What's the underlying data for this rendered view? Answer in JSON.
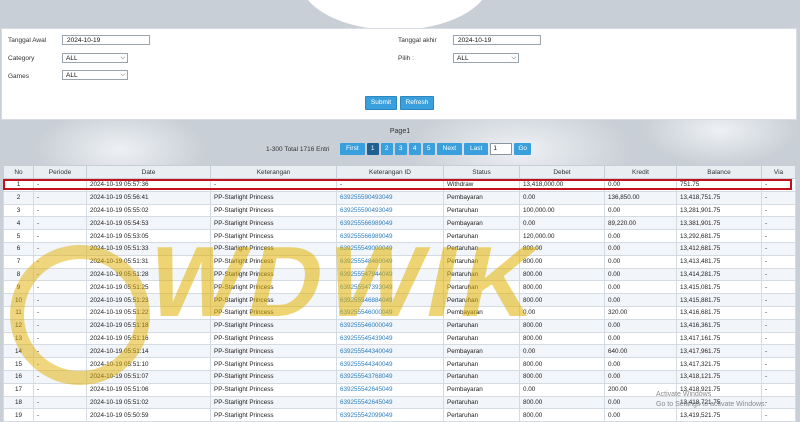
{
  "filters": {
    "tanggal_awal_label": "Tanggal Awal",
    "tanggal_awal_value": "2024-10-19",
    "tanggal_akhir_label": "Tanggal akhir",
    "tanggal_akhir_value": "2024-10-19",
    "category_label": "Category",
    "category_value": "ALL",
    "pilih_label": "Pilih :",
    "pilih_value": "ALL",
    "games_label": "Games",
    "games_value": "ALL",
    "submit_label": "Submit",
    "refresh_label": "Refresh"
  },
  "pagination": {
    "page_title": "Page1",
    "total_text": "1-300 Total 1716 Entri",
    "first": "First",
    "pages": [
      "1",
      "2",
      "3",
      "4",
      "5"
    ],
    "active_page": "1",
    "next": "Next",
    "last": "Last",
    "go_input": "1",
    "go": "Go"
  },
  "table": {
    "headers": [
      "No",
      "Periode",
      "Date",
      "Keterangan",
      "Keterangan ID",
      "Status",
      "Debet",
      "Kredit",
      "Balance",
      "Via"
    ],
    "rows": [
      [
        "1",
        "-",
        "2024-10-19 05:57:36",
        "-",
        "-",
        "Withdraw",
        "13,418,000.00",
        "0.00",
        "751.75",
        "-"
      ],
      [
        "2",
        "-",
        "2024-10-19 05:56:41",
        "PP-Starlight Princess",
        "639255590493049",
        "Pembayaran",
        "0.00",
        "136,850.00",
        "13,418,751.75",
        "-"
      ],
      [
        "3",
        "-",
        "2024-10-19 05:55:02",
        "PP-Starlight Princess",
        "639255590493049",
        "Pertaruhan",
        "100,000.00",
        "0.00",
        "13,281,901.75",
        "-"
      ],
      [
        "4",
        "-",
        "2024-10-19 05:54:53",
        "PP-Starlight Princess",
        "639255566989049",
        "Pembayaran",
        "0.00",
        "89,220.00",
        "13,381,901.75",
        "-"
      ],
      [
        "5",
        "-",
        "2024-10-19 05:53:05",
        "PP-Starlight Princess",
        "639255566989049",
        "Pertaruhan",
        "120,000.00",
        "0.00",
        "13,292,681.75",
        "-"
      ],
      [
        "6",
        "-",
        "2024-10-19 05:51:33",
        "PP-Starlight Princess",
        "639255549000049",
        "Pertaruhan",
        "800.00",
        "0.00",
        "13,412,681.75",
        "-"
      ],
      [
        "7",
        "-",
        "2024-10-19 05:51:31",
        "PP-Starlight Princess",
        "639255548460049",
        "Pertaruhan",
        "800.00",
        "0.00",
        "13,413,481.75",
        "-"
      ],
      [
        "8",
        "-",
        "2024-10-19 05:51:28",
        "PP-Starlight Princess",
        "639255547944049",
        "Pertaruhan",
        "800.00",
        "0.00",
        "13,414,281.75",
        "-"
      ],
      [
        "9",
        "-",
        "2024-10-19 05:51:25",
        "PP-Starlight Princess",
        "639255547393049",
        "Pertaruhan",
        "800.00",
        "0.00",
        "13,415,081.75",
        "-"
      ],
      [
        "10",
        "-",
        "2024-10-19 05:51:23",
        "PP-Starlight Princess",
        "639255546884049",
        "Pertaruhan",
        "800.00",
        "0.00",
        "13,415,881.75",
        "-"
      ],
      [
        "11",
        "-",
        "2024-10-19 05:51:22",
        "PP-Starlight Princess",
        "639255546000049",
        "Pembayaran",
        "0.00",
        "320.00",
        "13,416,681.75",
        "-"
      ],
      [
        "12",
        "-",
        "2024-10-19 05:51:18",
        "PP-Starlight Princess",
        "639255546000049",
        "Pertaruhan",
        "800.00",
        "0.00",
        "13,416,361.75",
        "-"
      ],
      [
        "13",
        "-",
        "2024-10-19 05:51:16",
        "PP-Starlight Princess",
        "639255545439049",
        "Pertaruhan",
        "800.00",
        "0.00",
        "13,417,161.75",
        "-"
      ],
      [
        "14",
        "-",
        "2024-10-19 05:51:14",
        "PP-Starlight Princess",
        "639255544340049",
        "Pembayaran",
        "0.00",
        "640.00",
        "13,417,961.75",
        "-"
      ],
      [
        "15",
        "-",
        "2024-10-19 05:51:10",
        "PP-Starlight Princess",
        "639255544340049",
        "Pertaruhan",
        "800.00",
        "0.00",
        "13,417,321.75",
        "-"
      ],
      [
        "16",
        "-",
        "2024-10-19 05:51:07",
        "PP-Starlight Princess",
        "639255543768049",
        "Pertaruhan",
        "800.00",
        "0.00",
        "13,418,121.75",
        "-"
      ],
      [
        "17",
        "-",
        "2024-10-19 05:51:06",
        "PP-Starlight Princess",
        "639255542645049",
        "Pembayaran",
        "0.00",
        "200.00",
        "13,418,921.75",
        "-"
      ],
      [
        "18",
        "-",
        "2024-10-19 05:51:02",
        "PP-Starlight Princess",
        "639255542645049",
        "Pertaruhan",
        "800.00",
        "0.00",
        "13,418,721.75",
        "-"
      ],
      [
        "19",
        "-",
        "2024-10-19 05:50:59",
        "PP-Starlight Princess",
        "639255542099049",
        "Pertaruhan",
        "800.00",
        "0.00",
        "13,419,521.75",
        "-"
      ]
    ]
  },
  "overlay": {
    "watermark_text": "WDWIK",
    "windows_activation_line1": "Activate Windows",
    "windows_activation_line2": "Go to Settings to activate Windows."
  },
  "colors": {
    "button_blue": "#3aa0dd",
    "page_active": "#1f5f92",
    "highlight_red": "#c2121b",
    "link_blue": "#2a7fc1",
    "watermark_gold": "#e2b000"
  }
}
